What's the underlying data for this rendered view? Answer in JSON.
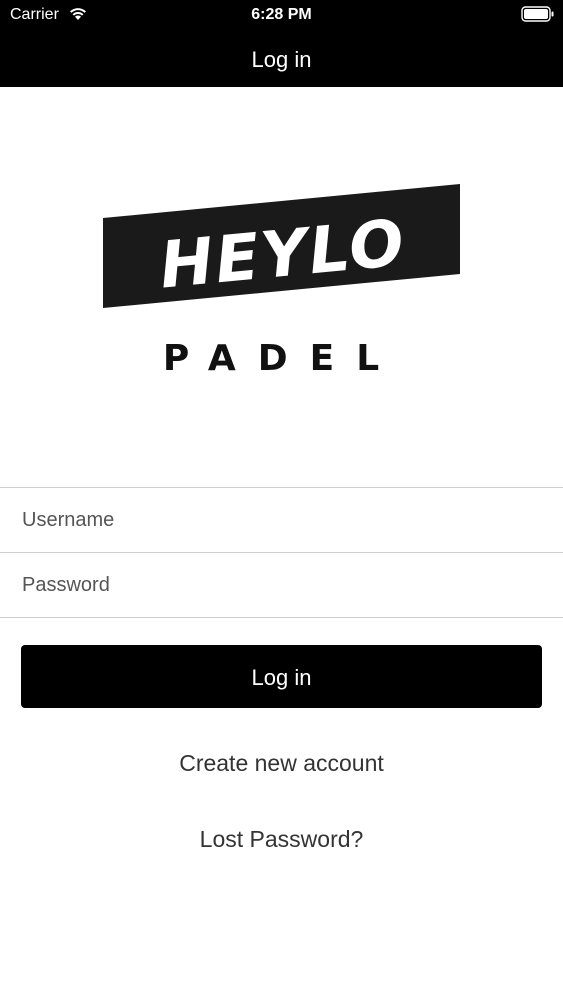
{
  "status_bar": {
    "carrier": "Carrier",
    "time": "6:28 PM",
    "wifi_icon": "wifi-icon",
    "battery_icon": "battery-icon"
  },
  "nav": {
    "title": "Log in"
  },
  "logo": {
    "brand_top": "HEYLO",
    "brand_bottom": "PADEL"
  },
  "form": {
    "username_placeholder": "Username",
    "password_placeholder": "Password",
    "login_button": "Log in"
  },
  "links": {
    "create_account": "Create new account",
    "lost_password": "Lost Password?"
  },
  "colors": {
    "bar_background": "#000000",
    "button_background": "#000000",
    "divider": "#cfcfcf",
    "link_text": "#333333"
  }
}
